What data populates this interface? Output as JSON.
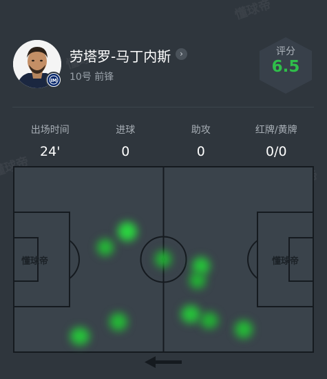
{
  "player": {
    "name": "劳塔罗-马丁内斯",
    "sub_info": "10号  前锋",
    "rating_label": "评分",
    "rating_value": "6.5",
    "arrow_glyph": "›"
  },
  "stats": [
    {
      "label": "出场时间",
      "value": "24'"
    },
    {
      "label": "进球",
      "value": "0"
    },
    {
      "label": "助攻",
      "value": "0"
    },
    {
      "label": "红牌/黄牌",
      "value": "0/0"
    }
  ],
  "pitch": {
    "watermark_left": "懂球帝",
    "watermark_right": "懂球帝"
  },
  "watermark": "懂球帝",
  "colors": {
    "background": "#2f363d",
    "rating": "#2fbf4a",
    "heat": "#27c83a",
    "pitch_lines": "#151a1f"
  },
  "icons": {
    "attack_direction": "arrow-left-icon",
    "profile_link": "chevron-right-icon",
    "club": "inter-badge-icon"
  }
}
